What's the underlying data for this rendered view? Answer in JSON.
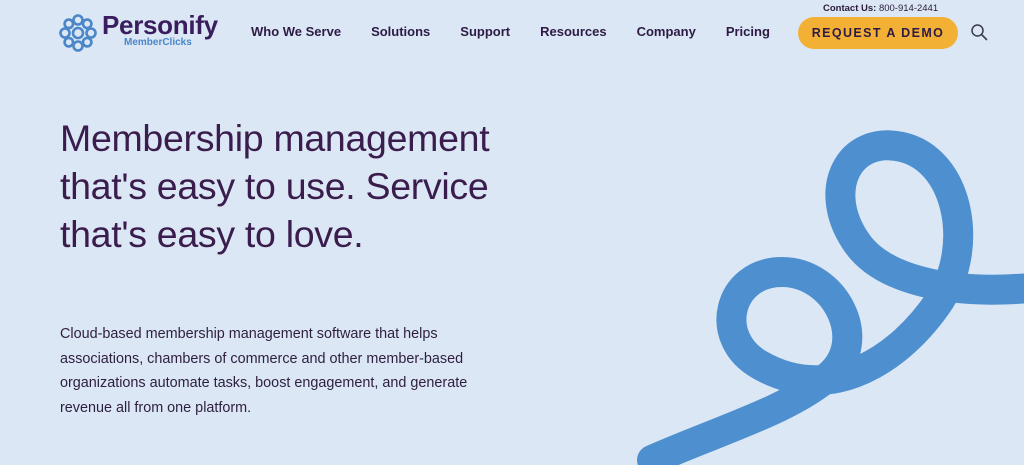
{
  "header": {
    "contact_label": "Contact Us:",
    "contact_phone": "800-914-2441",
    "logo_brand": "Personify",
    "logo_sub": "MemberClicks",
    "nav": [
      "Who We Serve",
      "Solutions",
      "Support",
      "Resources",
      "Company",
      "Pricing"
    ],
    "cta_label": "REQUEST A DEMO"
  },
  "hero": {
    "title": "Membership management that's easy to use. Service that's easy to love.",
    "body": "Cloud-based membership management software that helps associations, chambers of commerce and other member-based organizations automate tasks, boost engagement, and generate revenue all from one platform."
  },
  "colors": {
    "background": "#dbe7f5",
    "title": "#3a1d4d",
    "cta": "#f2b134",
    "swirl": "#4d8fcf",
    "logo_mark": "#4a86c8"
  },
  "icons": {
    "logo": "sunburst-logo-icon",
    "search": "search-icon",
    "decoration": "swirl-ribbon"
  }
}
